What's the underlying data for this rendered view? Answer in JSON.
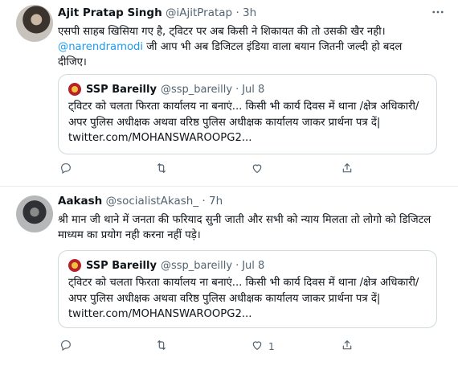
{
  "tweets": [
    {
      "name": "Ajit Pratap Singh",
      "handle": "@iAjitPratap",
      "dot": "·",
      "time": "3h",
      "text_line1": "एसपी साहब खिसिया गए है, ट्विटर पर अब किसी ने शिकायत की तो उसकी खैर नही।",
      "mention": "@narendramodi",
      "text_line2_rest": " जी आप भी अब डिजिटल इंडिया वाला बयान जितनी जल्दी हो बदल",
      "text_line3": "दीजिए।",
      "quote": {
        "name": "SSP Bareilly",
        "handle": "@ssp_bareilly",
        "dot": "·",
        "time": "Jul 8",
        "text": "ट्विटर को चलता फिरता कार्यालय ना बनाएं... किसी भी कार्य दिवस में थाना /क्षेत्र अधिकारी/ अपर पुलिस अधीक्षक अथवा वरिष्ठ पुलिस अधीक्षक कार्यालय जाकर प्रार्थना पत्र दें| twitter.com/MOHANSWAROOPG2..."
      },
      "actions": {
        "reply": "",
        "retweet": "",
        "like": ""
      }
    },
    {
      "name": "Aakash",
      "handle": "@socialistAkash_",
      "dot": "·",
      "time": "7h",
      "text": "श्री मान जी थाने में जनता की फरियाद सुनी जाती और सभी को न्याय मिलता तो लोगो को डिजिटल माध्यम का प्रयोग नही करना नहीं पड़े।",
      "quote": {
        "name": "SSP Bareilly",
        "handle": "@ssp_bareilly",
        "dot": "·",
        "time": "Jul 8",
        "text": "ट्विटर को चलता फिरता कार्यालय ना बनाएं... किसी भी कार्य दिवस में थाना /क्षेत्र अधिकारी/ अपर पुलिस अधीक्षक अथवा वरिष्ठ पुलिस अधीक्षक कार्यालय जाकर प्रार्थना पत्र दें| twitter.com/MOHANSWAROOPG2..."
      },
      "actions": {
        "reply": "",
        "retweet": "",
        "like": "1"
      }
    }
  ],
  "icons": {
    "more": "more-options-icon",
    "reply": "reply-icon",
    "retweet": "retweet-icon",
    "like": "like-icon",
    "share": "share-icon"
  },
  "colors": {
    "link": "#1d9bf0",
    "secondary_text": "#536471",
    "border": "#cfd9de"
  }
}
